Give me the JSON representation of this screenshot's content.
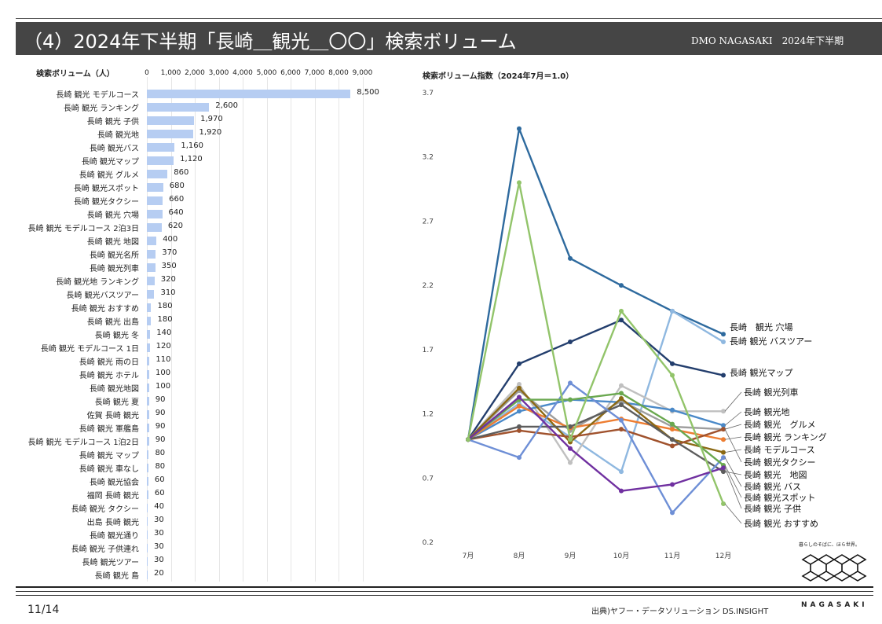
{
  "header": {
    "title": "（4）2024年下半期「長崎＿観光＿〇〇」検索ボリューム",
    "right": "DMO NAGASAKI　2024年下半期"
  },
  "footer": {
    "page": "11/14",
    "source": "出典)ヤフー・データソリューション  DS.INSIGHT",
    "logo_tagline": "暮らしのそばに、ほら世界。",
    "logo_word": "NAGASAKI"
  },
  "chart_data": [
    {
      "type": "bar",
      "orientation": "horizontal",
      "title": "検索ボリューム（人）",
      "xlim": [
        0,
        9000
      ],
      "xticks": [
        "0",
        "1,000",
        "2,000",
        "3,000",
        "4,000",
        "5,000",
        "6,000",
        "7,000",
        "8,000",
        "9,000"
      ],
      "grid": true,
      "color": "#b6cdf2",
      "categories": [
        "長崎 観光 モデルコース",
        "長崎 観光 ランキング",
        "長崎 観光 子供",
        "長崎 観光地",
        "長崎 観光バス",
        "長崎 観光マップ",
        "長崎 観光 グルメ",
        "長崎 観光スポット",
        "長崎 観光タクシー",
        "長崎 観光 穴場",
        "長崎 観光 モデルコース 2泊3日",
        "長崎 観光 地図",
        "長崎 観光名所",
        "長崎 観光列車",
        "長崎 観光地 ランキング",
        "長崎 観光バスツアー",
        "長崎 観光 おすすめ",
        "長崎 観光 出島",
        "長崎 観光 冬",
        "長崎 観光 モデルコース 1日",
        "長崎 観光 雨の日",
        "長崎 観光 ホテル",
        "長崎 観光地図",
        "長崎 観光 夏",
        "佐賀 長崎 観光",
        "長崎 観光 軍艦島",
        "長崎 観光 モデルコース 1泊2日",
        "長崎 観光 マップ",
        "長崎 観光 車なし",
        "長崎 観光協会",
        "福岡 長崎 観光",
        "長崎 観光 タクシー",
        "出島 長崎 観光",
        "長崎 観光通り",
        "長崎 観光 子供連れ",
        "長崎 観光ツアー",
        "長崎 観光 島"
      ],
      "values": [
        8500,
        2600,
        1970,
        1920,
        1160,
        1120,
        860,
        680,
        660,
        640,
        620,
        400,
        370,
        350,
        320,
        310,
        180,
        180,
        140,
        120,
        110,
        100,
        100,
        90,
        90,
        90,
        90,
        80,
        80,
        60,
        60,
        40,
        30,
        30,
        30,
        30,
        20
      ],
      "labels": [
        "8,500",
        "2,600",
        "1,970",
        "1,920",
        "1,160",
        "1,120",
        "860",
        "680",
        "660",
        "640",
        "620",
        "400",
        "370",
        "350",
        "320",
        "310",
        "180",
        "180",
        "140",
        "120",
        "110",
        "100",
        "100",
        "90",
        "90",
        "90",
        "90",
        "80",
        "80",
        "60",
        "60",
        "40",
        "30",
        "30",
        "30",
        "30",
        "20"
      ]
    },
    {
      "type": "line",
      "title": "検索ボリューム指数（2024年7月＝1.0）",
      "x": [
        "7月",
        "8月",
        "9月",
        "10月",
        "11月",
        "12月"
      ],
      "ylim": [
        0.2,
        3.7
      ],
      "yticks": [
        "0.2",
        "0.7",
        "1.2",
        "1.7",
        "2.2",
        "2.7",
        "3.2",
        "3.7"
      ],
      "grid": false,
      "series": [
        {
          "name": "長崎　観光 穴場",
          "color": "#2e6a9e",
          "values": [
            1.0,
            3.42,
            2.41,
            2.2,
            2.0,
            1.82
          ]
        },
        {
          "name": "長崎 観光 バスツアー",
          "color": "#8fb8e0",
          "values": [
            1.0,
            1.28,
            1.02,
            0.75,
            2.0,
            1.76
          ]
        },
        {
          "name": "長崎 観光マップ",
          "color": "#233e6d",
          "values": [
            1.0,
            1.59,
            1.76,
            1.93,
            1.59,
            1.5
          ]
        },
        {
          "name": "長崎 観光列車",
          "color": "#c0c0c0",
          "values": [
            1.0,
            1.43,
            0.82,
            1.42,
            1.22,
            1.22
          ]
        },
        {
          "name": "長崎 観光地",
          "color": "#4a89c8",
          "values": [
            1.0,
            1.22,
            1.31,
            1.29,
            1.23,
            1.11
          ]
        },
        {
          "name": "長崎 観光　グルメ",
          "color": "#9e9e9e",
          "values": [
            1.0,
            1.38,
            1.07,
            1.3,
            1.1,
            1.08
          ]
        },
        {
          "name": "長崎 観光 ランキング",
          "color": "#ed7d31",
          "values": [
            1.0,
            1.26,
            1.09,
            1.16,
            1.08,
            1.0
          ]
        },
        {
          "name": "長崎 モデルコース",
          "color": "#8b6914",
          "values": [
            1.0,
            1.4,
            0.98,
            1.32,
            1.0,
            0.9
          ]
        },
        {
          "name": "長崎 観光タクシー",
          "color": "#a0522d",
          "values": [
            1.0,
            1.07,
            1.02,
            1.08,
            0.95,
            1.08
          ]
        },
        {
          "name": "長崎 観光　地図",
          "color": "#5d5d5d",
          "values": [
            1.0,
            1.1,
            1.1,
            1.27,
            1.0,
            0.75
          ]
        },
        {
          "name": "長崎 観光 バス",
          "color": "#6e8fd6",
          "values": [
            1.0,
            0.86,
            1.44,
            1.15,
            0.43,
            0.86
          ]
        },
        {
          "name": "長崎 観光スポット",
          "color": "#6aa84f",
          "values": [
            1.0,
            1.31,
            1.31,
            1.36,
            1.12,
            0.8
          ]
        },
        {
          "name": "長崎 観光 子供",
          "color": "#7030a0",
          "values": [
            1.0,
            1.33,
            0.93,
            0.6,
            0.65,
            0.78
          ]
        },
        {
          "name": "長崎 観光 おすすめ",
          "color": "#92c46a",
          "values": [
            1.0,
            3.0,
            1.0,
            2.0,
            1.5,
            0.5
          ]
        }
      ]
    }
  ]
}
